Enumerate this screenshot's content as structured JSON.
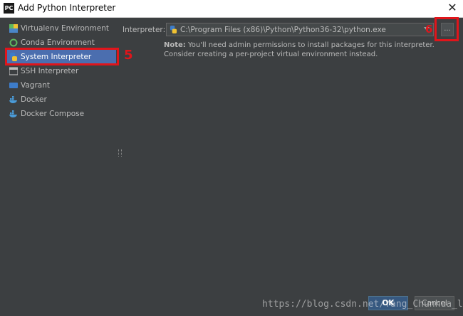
{
  "window": {
    "title": "Add Python Interpreter",
    "app_icon_text": "PC"
  },
  "sidebar": {
    "items": [
      {
        "label": "Virtualenv Environment",
        "icon": "virtualenv-icon"
      },
      {
        "label": "Conda Environment",
        "icon": "conda-icon"
      },
      {
        "label": "System Interpreter",
        "icon": "python-icon",
        "selected": true
      },
      {
        "label": "SSH Interpreter",
        "icon": "ssh-icon"
      },
      {
        "label": "Vagrant",
        "icon": "vagrant-icon"
      },
      {
        "label": "Docker",
        "icon": "docker-icon"
      },
      {
        "label": "Docker Compose",
        "icon": "docker-compose-icon"
      }
    ]
  },
  "annotations": {
    "marker_5": "5",
    "marker_6": "6",
    "color": "#e0151b"
  },
  "main": {
    "interpreter_label": "Interpreter:",
    "interpreter_value": "C:\\Program Files (x86)\\Python\\Python36-32\\python.exe",
    "browse_label": "...",
    "note_bold": "Note:",
    "note_text": " You'll need admin permissions to install packages for this interpreter. Consider creating a per-project virtual environment instead."
  },
  "buttons": {
    "ok": "OK",
    "cancel": "Cancel"
  },
  "watermark": "https://blog.csdn.net/Yang_Chunhua_lin",
  "colors": {
    "background": "#3c3f41",
    "selection": "#4b6eaf",
    "ok_button": "#365880"
  }
}
